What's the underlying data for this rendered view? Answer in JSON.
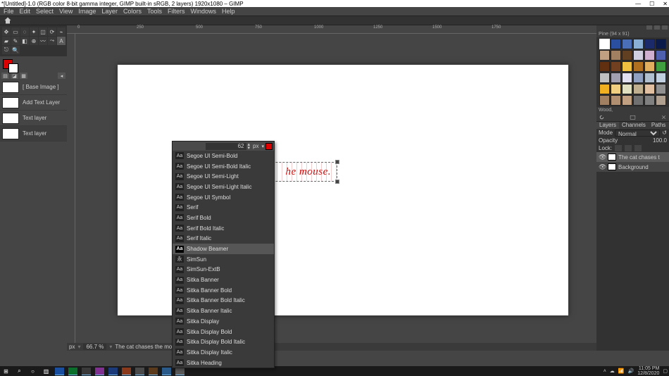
{
  "titlebar": {
    "title": "*[Untitled]-1.0 (RGB color 8-bit gamma integer, GIMP built-in sRGB, 2 layers) 1920x1080 – GIMP",
    "min": "—",
    "max": "☐",
    "close": "✕"
  },
  "menu": {
    "file": "File",
    "edit": "Edit",
    "select": "Select",
    "view": "View",
    "image": "Image",
    "layer": "Layer",
    "colors": "Colors",
    "tools": "Tools",
    "filters": "Filters",
    "windows": "Windows",
    "help": "Help"
  },
  "layers_left": {
    "items": [
      {
        "label": "[ Base Image ]"
      },
      {
        "label": "Add Text Layer"
      },
      {
        "label": "Text layer"
      },
      {
        "label": "Text layer"
      }
    ]
  },
  "ruler_ticks": [
    "0",
    "250",
    "500",
    "750",
    "1000",
    "1250",
    "1500",
    "1750"
  ],
  "text_on_canvas": "he mouse.",
  "font_size": "62",
  "font_unit": "px",
  "font_list": [
    "Segoe UI Semi-Bold",
    "Segoe UI Semi-Bold Italic",
    "Segoe UI Semi-Light",
    "Segoe UI Semi-Light Italic",
    "Segoe UI Symbol",
    "Serif",
    "Serif Bold",
    "Serif Bold Italic",
    "Serif Italic",
    "Shadow Beamer",
    "SimSun",
    "SimSun-ExtB",
    "Sitka Banner",
    "Sitka Banner Bold",
    "Sitka Banner Bold Italic",
    "Sitka Banner Italic",
    "Sitka Display",
    "Sitka Display Bold",
    "Sitka Display Bold Italic",
    "Sitka Display Italic",
    "Sitka Heading"
  ],
  "font_selected_index": 9,
  "patterns_label": "Pine (94 x 91)",
  "patterns_footer": "Wood,",
  "right_panel": {
    "tabs": {
      "layers": "Layers",
      "channels": "Channels",
      "paths": "Paths"
    },
    "mode_label": "Mode",
    "mode_value": "Normal",
    "opacity_label": "Opacity",
    "opacity_value": "100.0",
    "lock_label": "Lock:",
    "layers": [
      {
        "name": "The cat chases t"
      },
      {
        "name": "Background"
      }
    ]
  },
  "status": {
    "unit": "px",
    "zoom": "66.7 %",
    "text": "The cat chases the mo"
  },
  "taskbar": {
    "time": "11:05 PM",
    "date": "12/8/2020"
  },
  "pattern_colors": [
    "#ffffff",
    "#2a4fa0",
    "#4a6fb8",
    "#8ab0d8",
    "#1a2a6a",
    "#0a1a4a",
    "#c0a080",
    "#a08060",
    "#604020",
    "#d0d0e0",
    "#d0b0d0",
    "#5060b0",
    "#603010",
    "#704020",
    "#f0c040",
    "#b07020",
    "#e0b060",
    "#40a040",
    "#c0c0c0",
    "#a0a0b0",
    "#e0e0f0",
    "#90a0c0",
    "#b0c0d0",
    "#c0d0e0",
    "#f0b020",
    "#f0d080",
    "#e0e0c0",
    "#c0b090",
    "#e0c0a0",
    "#909090",
    "#a08060",
    "#b09070",
    "#c0a080",
    "#707070",
    "#808080",
    "#b0a090"
  ]
}
